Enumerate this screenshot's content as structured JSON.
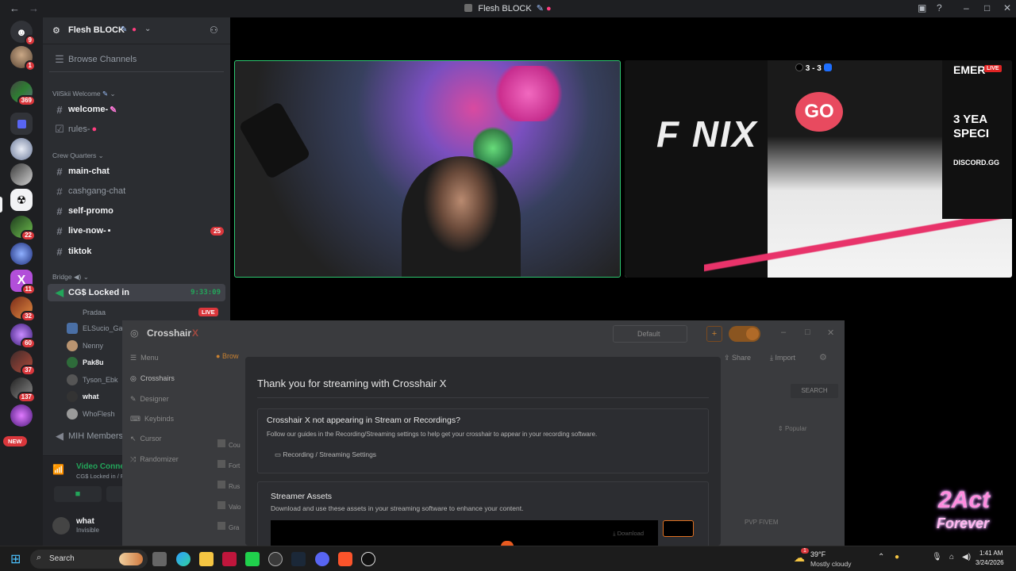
{
  "titlebar": {
    "back": "←",
    "forward": "→",
    "title": "Flesh BLOCK"
  },
  "rail": {
    "badges": [
      "9",
      "1",
      "369",
      "22",
      "11",
      "32",
      "60",
      "37",
      "137"
    ],
    "new_label": "NEW"
  },
  "server": {
    "name": "Flesh BLOCK",
    "browse_channels": "Browse Channels"
  },
  "channels": {
    "cat1": "VilSkii Welcome",
    "welcome": "welcome-",
    "rules": "rules-",
    "cat2": "Crew Quarters",
    "main_chat": "main-chat",
    "cashgang_chat": "cashgang-chat",
    "self_promo": "self-promo",
    "live_now": "live-now-",
    "live_now_count": "25",
    "tiktok": "tiktok",
    "cat3": "Bridge",
    "voice_channel": "CG$ Locked in",
    "voice_timer": "9:33:09",
    "voice_users": [
      "Pradaa",
      "ELSucio_Ga",
      "Nenny",
      "Pak8u",
      "Tyson_Ebk",
      "what",
      "WhoFlesh"
    ],
    "live_badge": "LIVE",
    "mih_members": "MIH Members"
  },
  "voice_panel": {
    "status": "Video Connected",
    "location": "CG$ Locked in / Flesh BLOCK"
  },
  "user_panel": {
    "name": "what",
    "status": "Invisible"
  },
  "stream": {
    "score": "3 - 3",
    "go_label": "GO",
    "sign1": "EMER",
    "sign2": "3 YEA",
    "sign3": "SPECI",
    "discord_sign": "DISCORD.GG",
    "live_label": "LIVE"
  },
  "crosshair_app": {
    "title": "Crosshair",
    "title_x": "X",
    "profile": "Default",
    "menu": "Menu",
    "crosshairs": "Crosshairs",
    "designer": "Designer",
    "keybinds": "Keybinds",
    "cursor": "Cursor",
    "randomizer": "Randomizer",
    "browse": "Brow",
    "share": "Share",
    "import": "Import",
    "search": "SEARCH",
    "popular": "Popular",
    "pvp_fivem": "PVP FIVEM",
    "list_items": [
      "Cou",
      "Fort",
      "Rus",
      "Valo",
      "Gra"
    ]
  },
  "modal": {
    "title": "Thank you for streaming with Crosshair X",
    "card1_title": "Crosshair X not appearing in Stream or Recordings?",
    "card1_desc": "Follow our guides in the Recording/Streaming settings to help get your crosshair to appear in your recording software.",
    "card1_link": "Recording / Streaming Settings",
    "card2_title": "Streamer Assets",
    "card2_desc": "Download and use these assets in your streaming software to enhance your content.",
    "download": "Download"
  },
  "taskbar": {
    "search": "Search",
    "weather_temp": "39°F",
    "weather_desc": "Mostly cloudy",
    "weather_badge": "1",
    "time": "1:41 AM",
    "date": "3/24/2026"
  },
  "overlay_logo": {
    "line1": "2Act",
    "line2": "Forever"
  },
  "colors": {
    "discord_bg": "#2b2d31",
    "rail_bg": "#1e1f22",
    "accent_green": "#23a55a",
    "live_red": "#da373c",
    "crosshair_orange": "#f0a030"
  }
}
